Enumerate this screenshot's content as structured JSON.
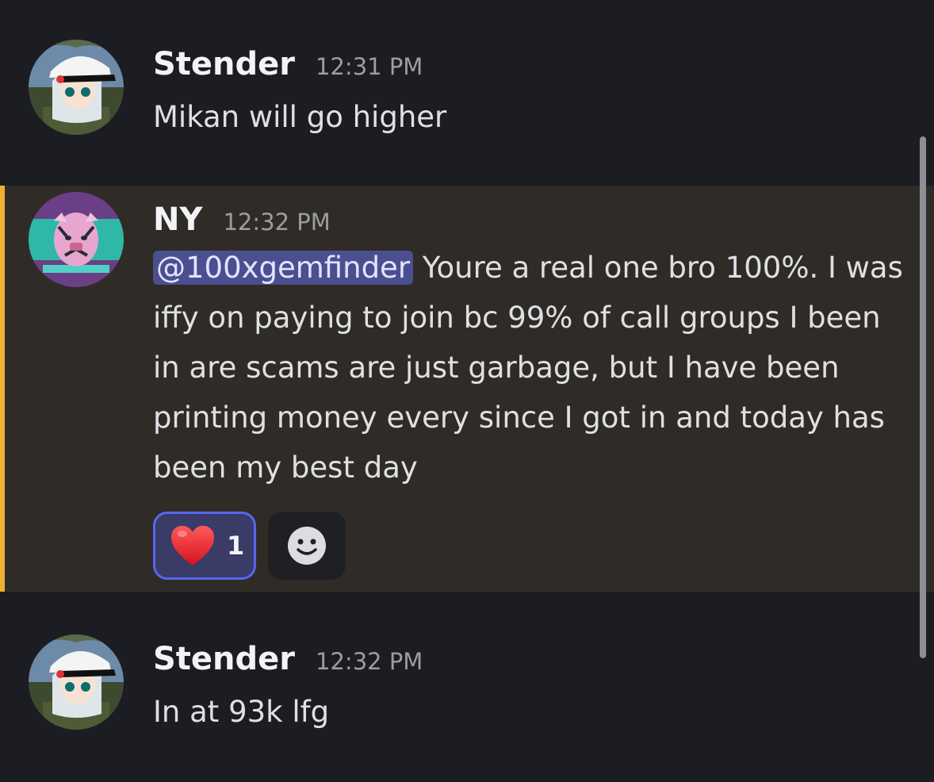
{
  "messages": [
    {
      "username": "Stender",
      "timestamp": "12:31 PM",
      "text": "Mikan will go higher",
      "avatar_icon": "anime-girl-cap-avatar"
    },
    {
      "username": "NY",
      "timestamp": "12:32 PM",
      "mention": "@100xgemfinder",
      "text": " Youre a real one bro 100%. I was iffy on paying to join bc 99% of call groups I been in are scams are just garbage, but I have been printing money every since I got in and today has been my best day",
      "avatar_icon": "pink-tiger-avatar",
      "highlight_color": "#f0b132",
      "reactions": [
        {
          "emoji": "❤️",
          "count": "1",
          "active": true
        }
      ],
      "add_reaction_icon": "smiley-icon"
    },
    {
      "username": "Stender",
      "timestamp": "12:32 PM",
      "text": "In at 93k lfg",
      "avatar_icon": "anime-girl-cap-avatar"
    }
  ],
  "colors": {
    "background": "#1c1d22",
    "highlighted_message_bg": "#2f2c27",
    "mention_bg": "#4b4f8f",
    "reaction_active_border": "#5865f2",
    "username": "#f2f3f5",
    "timestamp": "#9c9da3"
  }
}
